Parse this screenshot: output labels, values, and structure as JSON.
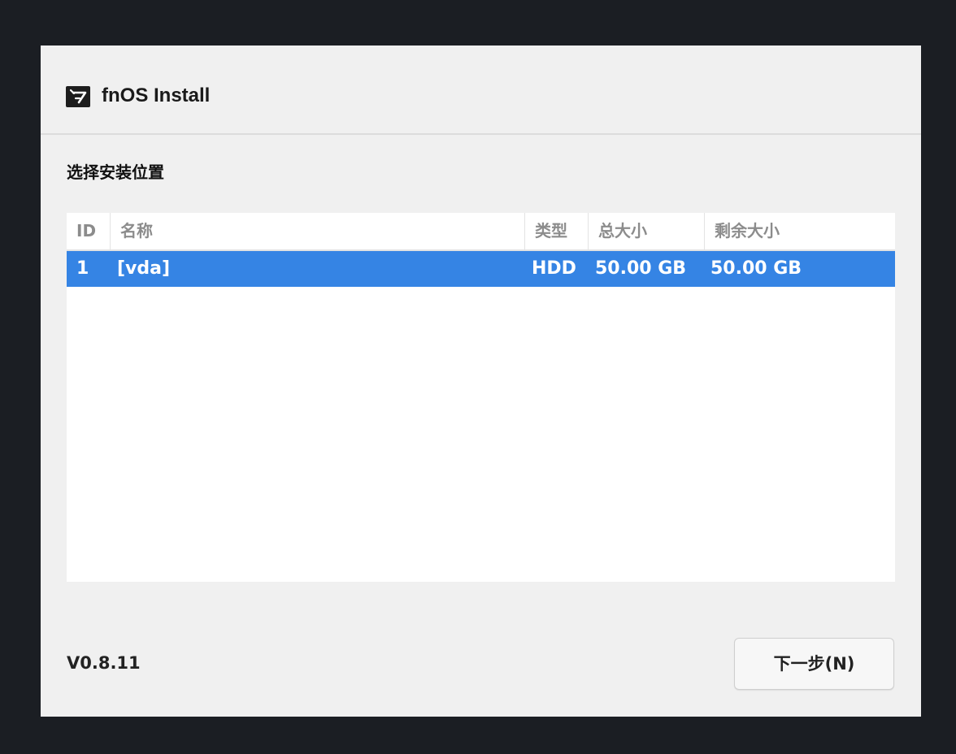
{
  "window": {
    "title": "fnOS Install",
    "logo_icon": "fnos-logo-icon"
  },
  "page": {
    "heading": "选择安装位置"
  },
  "disk_table": {
    "columns": [
      "ID",
      "名称",
      "类型",
      "总大小",
      "剩余大小"
    ],
    "rows": [
      {
        "id": "1",
        "name": "[vda]",
        "type": "HDD",
        "total_size": "50.00 GB",
        "free_size": "50.00 GB",
        "selected": true
      }
    ]
  },
  "footer": {
    "version": "V0.8.11",
    "next_button": "下一步(N)"
  },
  "colors": {
    "background": "#1b1e23",
    "window": "#f0f0f0",
    "selection": "#3584e4"
  }
}
